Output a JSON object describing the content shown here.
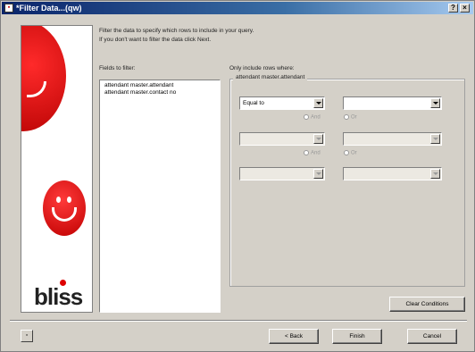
{
  "window": {
    "title": "*Filter Data...(qw)",
    "close_label": "×",
    "help_label": "?"
  },
  "header": {
    "instruction_line1": "Filter the data to specify which rows to include in your query.",
    "instruction_line2": "If you don't want to filter the data click Next."
  },
  "fields": {
    "label": "Fields to filter:",
    "items": [
      "attendant master.attendant",
      "attendant master.contact no"
    ]
  },
  "conditions": {
    "label": "Only include rows where:",
    "group_caption": "attendant master.attendant",
    "rows": [
      {
        "left_value": "Equal to",
        "right_value": "",
        "disabled": false
      },
      {
        "left_value": "",
        "right_value": "",
        "disabled": true
      },
      {
        "left_value": "",
        "right_value": "",
        "disabled": true
      }
    ],
    "radio_and": "And",
    "radio_or": "Or",
    "clear_button": "Clear Conditions"
  },
  "footer": {
    "back_button": "< Back",
    "finish_button": "Finish",
    "cancel_button": "Cancel"
  },
  "brand": {
    "logo_text": "bliss",
    "accent_color": "#cc0000"
  }
}
